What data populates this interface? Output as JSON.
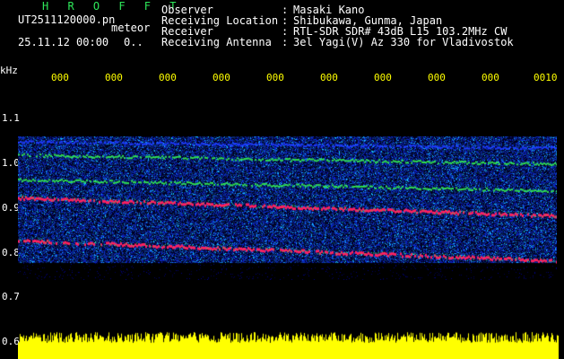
{
  "header": {
    "title": "H R O F F T",
    "filename": "UT2511120000.pn",
    "meteor_label": "meteor",
    "datetime": "25.11.12 00:00",
    "count": "0..",
    "info": [
      {
        "label": "Observer",
        "value": "Masaki Kano"
      },
      {
        "label": "Receiving Location",
        "value": "Shibukawa, Gunma, Japan"
      },
      {
        "label": "Receiver",
        "value": "RTL-SDR SDR# 43dB L15 103.2MHz CW"
      },
      {
        "label": "Receiving Antenna",
        "value": "3el Yagi(V) Az 330 for Vladivostok"
      }
    ]
  },
  "colors": {
    "background": "#000000",
    "title": "#2ee85a",
    "x_tick_labels": "#ffff00",
    "activity_bars": "#ffff00",
    "signal_strong": "#ff2060",
    "signal_medium": "#30e050",
    "signal_weak": "#1e3cff"
  },
  "chart_data": {
    "type": "heatmap",
    "ylabel": "kHz",
    "y_ticks": [
      "1.1",
      "1.0",
      "0.9",
      "0.8",
      "0.7",
      "0.6"
    ],
    "ylim": [
      0.6,
      1.15
    ],
    "x_ticks": [
      "000",
      "000",
      "000",
      "000",
      "000",
      "000",
      "000",
      "000",
      "000",
      "0010"
    ],
    "signals": [
      {
        "name": "",
        "start_khz": 1.05,
        "end_khz": 1.035,
        "intensity": "weak"
      },
      {
        "name": "",
        "start_khz": 1.02,
        "end_khz": 1.0,
        "intensity": "medium"
      },
      {
        "name": "",
        "start_khz": 0.965,
        "end_khz": 0.94,
        "intensity": "medium"
      },
      {
        "name": "",
        "start_khz": 0.925,
        "end_khz": 0.885,
        "intensity": "strong"
      },
      {
        "name": "",
        "start_khz": 0.83,
        "end_khz": 0.785,
        "intensity": "strong"
      }
    ],
    "noise_band_khz": [
      0.78,
      1.06
    ]
  }
}
